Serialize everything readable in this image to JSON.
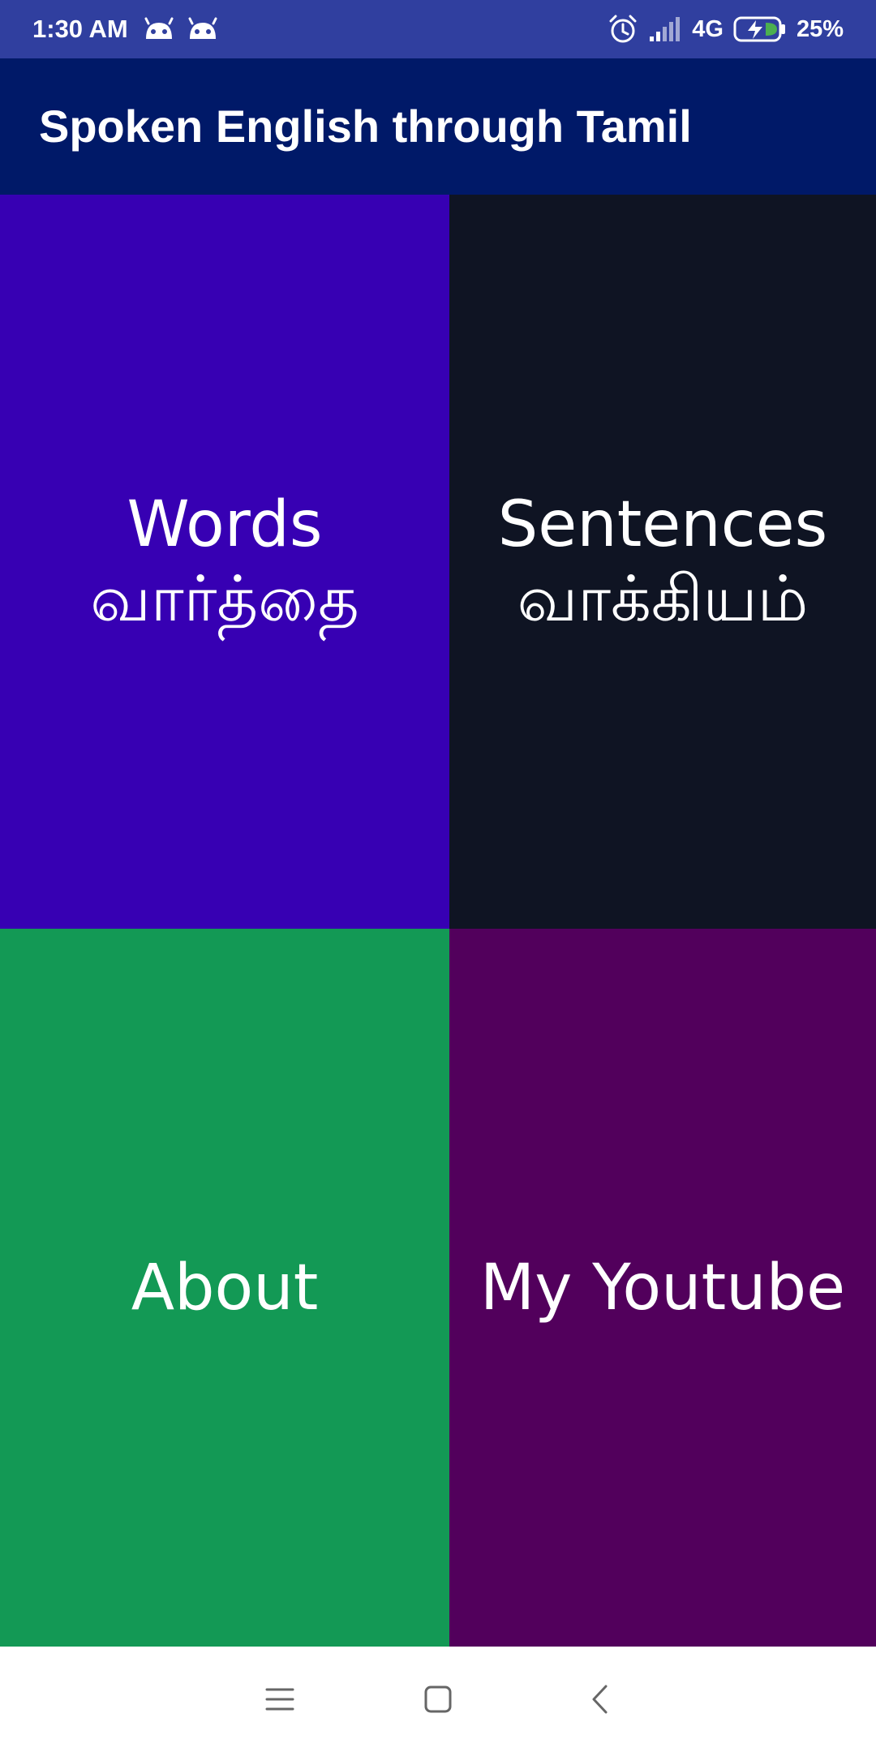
{
  "status_bar": {
    "time": "1:30 AM",
    "network": "4G",
    "battery": "25%",
    "background": "#303f9f",
    "icons": [
      "android-notification-icon",
      "android-notification-icon",
      "alarm-icon",
      "signal-icon",
      "battery-charging-icon"
    ]
  },
  "app_bar": {
    "title": "Spoken English through Tamil",
    "background": "#001968"
  },
  "tiles": [
    {
      "line1": "Words",
      "line2": "வார்த்தை",
      "color": "#3700b3"
    },
    {
      "line1": "Sentences",
      "line2": "வாக்கியம்",
      "color": "#0f1423"
    },
    {
      "line1": "About",
      "color": "#139955"
    },
    {
      "line1": "My Youtube",
      "color": "#52005c"
    }
  ],
  "nav_bar": {
    "icons": [
      "menu-icon",
      "home-icon",
      "back-icon"
    ]
  }
}
